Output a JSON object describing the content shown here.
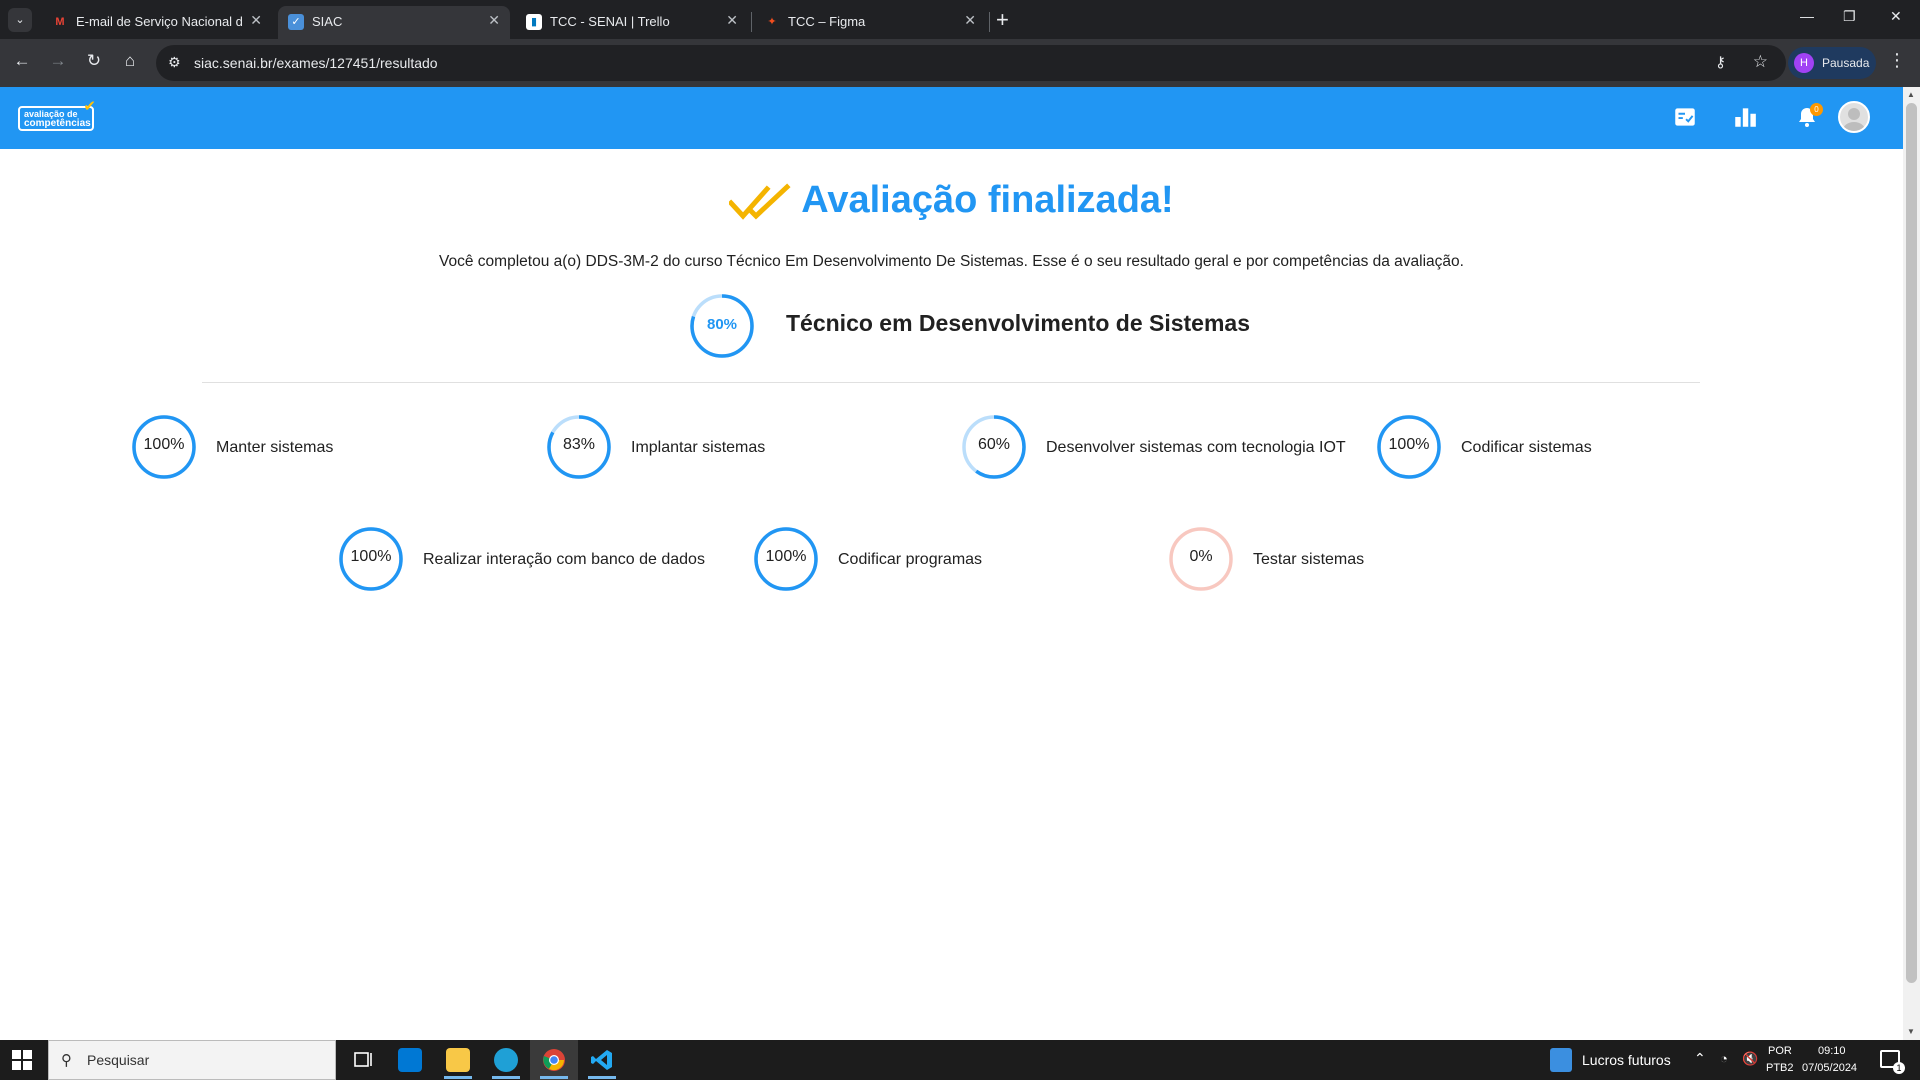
{
  "browser": {
    "tabs": [
      {
        "title": "E-mail de Serviço Nacional de A",
        "icon": "gmail-icon",
        "color": "#ea4335"
      },
      {
        "title": "SIAC",
        "icon": "siac-icon",
        "color": "#4a90d9"
      },
      {
        "title": "TCC - SENAI | Trello",
        "icon": "trello-icon",
        "color": "#0079bf"
      },
      {
        "title": "TCC – Figma",
        "icon": "figma-icon",
        "color": "#f24e1e"
      }
    ],
    "url": "siac.senai.br/exames/127451/resultado",
    "profile_initial": "H",
    "profile_status": "Pausada"
  },
  "app": {
    "logo_line1": "avaliação de",
    "logo_line2": "competências",
    "notification_count": "0",
    "accent_color": "#2196f3",
    "warning_color": "#f4b400"
  },
  "result": {
    "heading": "Avaliação finalizada!",
    "subtitle": "Você completou a(o) DDS-3M-2 do curso Técnico Em Desenvolvimento De Sistemas. Esse é o seu resultado geral e por competências da avaliação.",
    "overall": {
      "name": "Técnico em Desenvolvimento de Sistemas",
      "percent_label": "80%",
      "percent": 80
    },
    "competencies": [
      {
        "name": "Manter sistemas",
        "percent_label": "100%",
        "percent": 100
      },
      {
        "name": "Implantar sistemas",
        "percent_label": "83%",
        "percent": 83
      },
      {
        "name": "Desenvolver sistemas com tecnologia IOT",
        "percent_label": "60%",
        "percent": 60
      },
      {
        "name": "Codificar sistemas",
        "percent_label": "100%",
        "percent": 100
      },
      {
        "name": "Realizar interação com banco de dados",
        "percent_label": "100%",
        "percent": 100
      },
      {
        "name": "Codificar programas",
        "percent_label": "100%",
        "percent": 100
      },
      {
        "name": "Testar sistemas",
        "percent_label": "0%",
        "percent": 0
      }
    ]
  },
  "taskbar": {
    "search_placeholder": "Pesquisar",
    "widget_label": "Lucros futuros",
    "language": "POR",
    "layout": "PTB2",
    "time": "09:10",
    "date": "07/05/2024",
    "notification_count": "1"
  }
}
